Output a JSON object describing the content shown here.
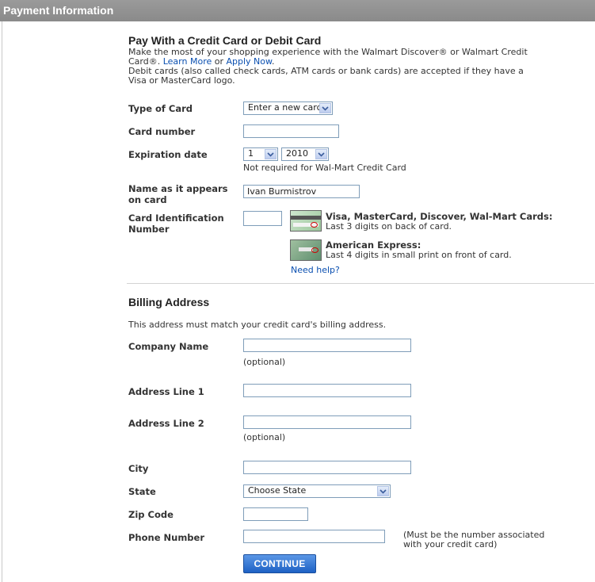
{
  "header": {
    "title": "Payment Information"
  },
  "pay": {
    "title": "Pay With a Credit Card or Debit Card",
    "intro_line1": "Make the most of your shopping experience with the Walmart Discover® or Walmart Credit",
    "intro_line2_prefix": "Card®. ",
    "learn_more": "Learn More",
    "or": " or ",
    "apply_now": "Apply Now",
    "period": ".",
    "debit_line1": "Debit cards (also called check cards, ATM cards or bank cards) are accepted if they have a",
    "debit_line2": "Visa or MasterCard logo."
  },
  "card_form": {
    "type_label": "Type of Card",
    "type_value": "Enter a new card",
    "number_label": "Card number",
    "number_value": "",
    "exp_label": "Expiration date",
    "exp_month": "1",
    "exp_year": "2010",
    "exp_note": "Not required for Wal-Mart Credit Card",
    "name_label_line1": "Name as it appears",
    "name_label_line2": "on card",
    "name_value": "Ivan Burmistrov",
    "cid_label_line1": "Card Identification",
    "cid_label_line2": "Number",
    "cid_value": "",
    "visa_title": "Visa, MasterCard, Discover, Wal-Mart Cards:",
    "visa_desc": "Last 3 digits on back of card.",
    "amex_title": "American Express:",
    "amex_desc": "Last 4 digits in small print on front of card.",
    "need_help": "Need help?"
  },
  "billing": {
    "title": "Billing Address",
    "note": "This address must match your credit card's billing address.",
    "company_label": "Company Name",
    "company_value": "",
    "optional": "(optional)",
    "address1_label": "Address Line 1",
    "address1_value": "",
    "address2_label": "Address Line 2",
    "address2_value": "",
    "city_label": "City",
    "city_value": "",
    "state_label": "State",
    "state_value": "Choose State",
    "zip_label": "Zip Code",
    "zip_value": "",
    "phone_label": "Phone Number",
    "phone_value": "",
    "phone_note_line1": "(Must be the number associated",
    "phone_note_line2": "with your credit card)"
  },
  "actions": {
    "continue": "CONTINUE"
  },
  "icons": {
    "dropdown": "chevron-down-icon",
    "card_back": "card-back-icon",
    "card_front": "amex-card-icon"
  },
  "colors": {
    "header_bg": "#8f8f8f",
    "link": "#0a4fb0",
    "button": "#2a6fd2"
  }
}
